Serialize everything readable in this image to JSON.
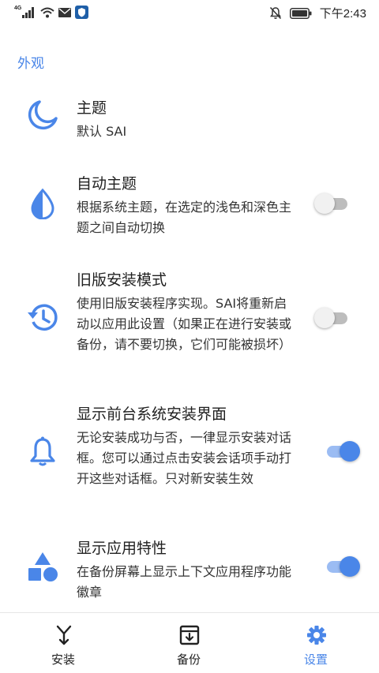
{
  "status_bar": {
    "network_label": "4G",
    "time": "下午2:43"
  },
  "section": {
    "title": "外观"
  },
  "settings": [
    {
      "title": "主题",
      "summary": "默认 SAI",
      "icon": "moon-icon"
    },
    {
      "title": "自动主题",
      "summary": "根据系统主题，在选定的浅色和深色主题之间自动切换",
      "icon": "water-drop-icon",
      "enabled": false
    },
    {
      "title": "旧版安装模式",
      "summary": "使用旧版安装程序实现。SAI将重新启动以应用此设置（如果正在进行安装或备份，请不要切换，它们可能被损坏）",
      "icon": "history-icon",
      "enabled": false
    },
    {
      "title": "显示前台系统安装界面",
      "summary": "无论安装成功与否，一律显示安装对话框。您可以通过点击安装会话项手动打开这些对话框。只对新安装生效",
      "icon": "bell-icon",
      "enabled": true
    },
    {
      "title": "显示应用特性",
      "summary": "在备份屏幕上显示上下文应用程序功能徽章",
      "icon": "shapes-icon",
      "enabled": true
    }
  ],
  "bottom_nav": [
    {
      "label": "安装",
      "icon": "install-icon",
      "active": false
    },
    {
      "label": "备份",
      "icon": "backup-icon",
      "active": false
    },
    {
      "label": "设置",
      "icon": "gear-icon",
      "active": true
    }
  ],
  "colors": {
    "accent": "#4A86E8",
    "text_primary": "#212121",
    "text_secondary": "#333333"
  }
}
